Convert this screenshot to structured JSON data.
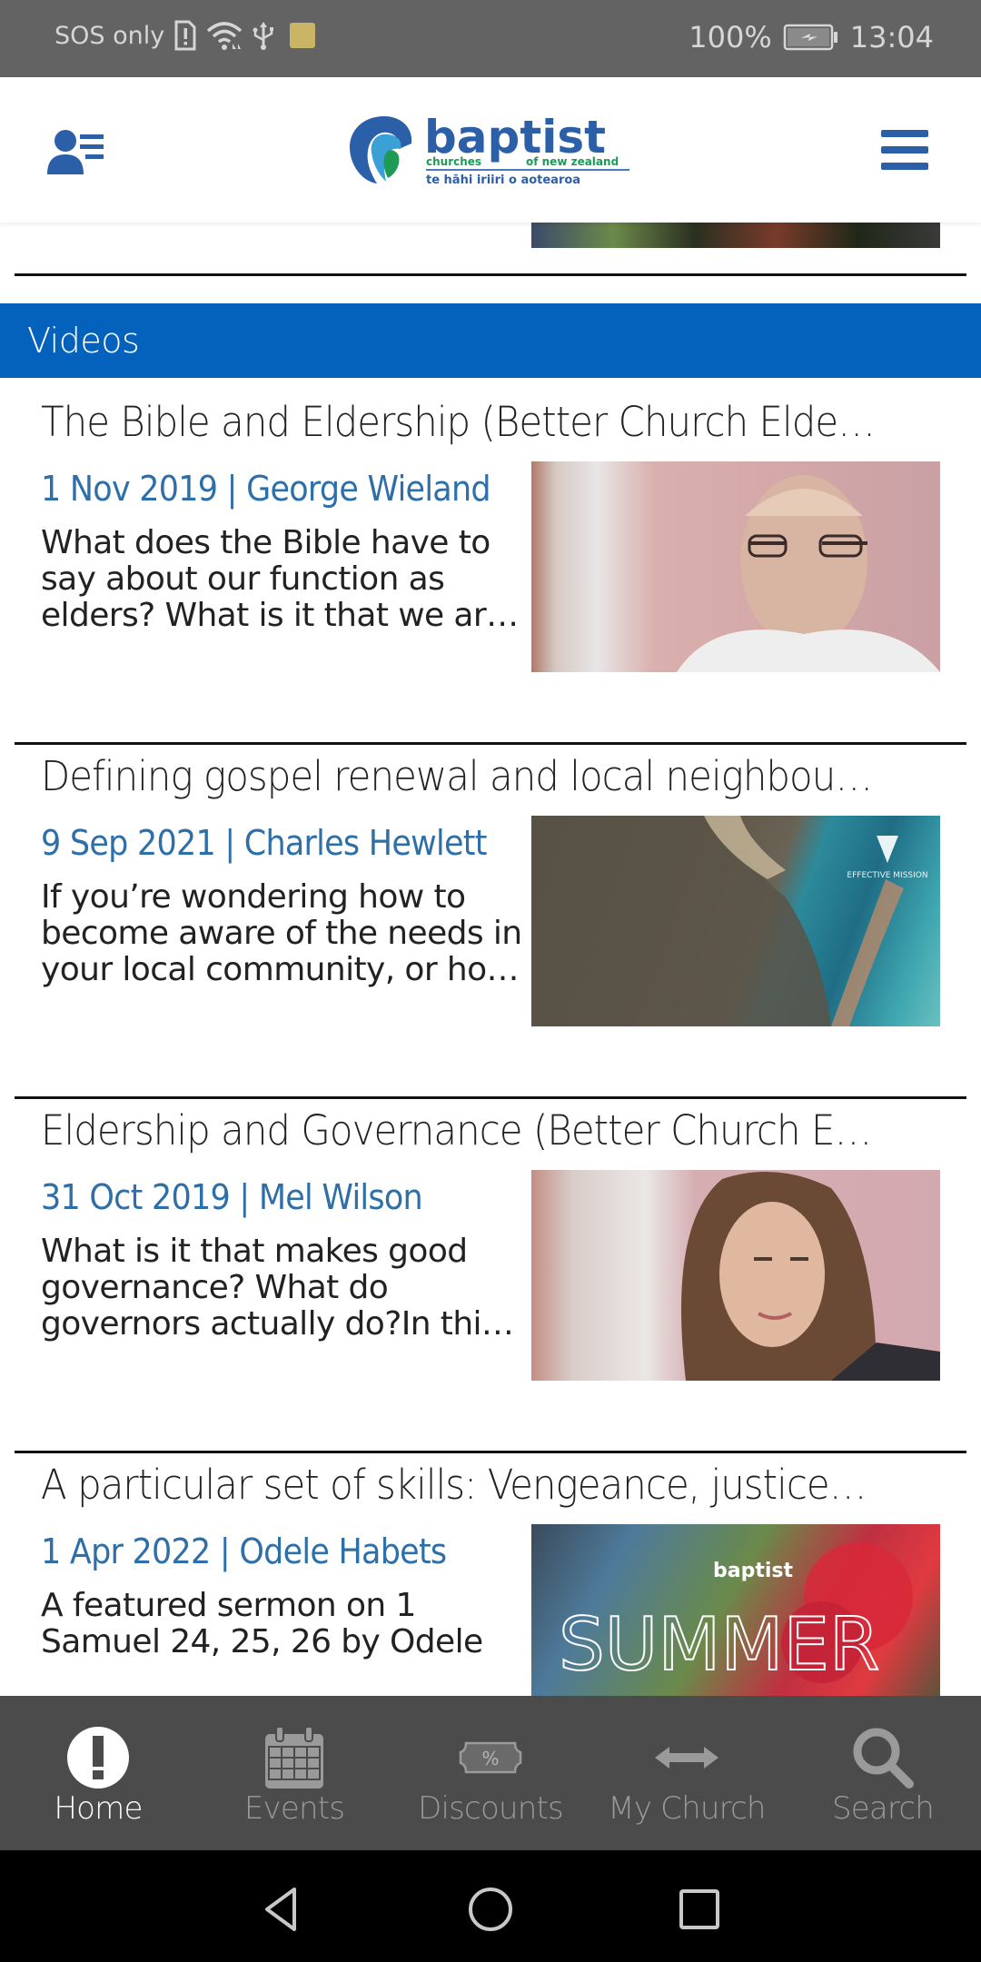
{
  "status_bar": {
    "carrier": "SOS only",
    "battery": "100%",
    "time": "13:04"
  },
  "header": {
    "logo_text": "baptist",
    "logo_subtitle_left": "churches",
    "logo_subtitle_right": "of new zealand",
    "logo_tagline": "te hāhi iriiri o aotearoa",
    "brand_color": "#2b5fa8",
    "accent_green": "#1e9a55"
  },
  "section": {
    "title": "Videos",
    "color": "#0462bc"
  },
  "videos": [
    {
      "title": "The Bible and Eldership (Better Church Elder…",
      "meta": "1 Nov 2019 | George Wieland",
      "description": "What does the Bible have to say about our function as elders? What is it that we ar…"
    },
    {
      "title": "Defining gospel renewal and local neighbour…",
      "meta": "9 Sep 2021 | Charles Hewlett",
      "description": "If you’re wondering how to become aware of the needs in your local community, or ho…"
    },
    {
      "title": "Eldership and Governance (Better Church El…",
      "meta": "31 Oct 2019 | Mel Wilson",
      "description": "What is it that makes good governance? What do governors actually do?In thi…"
    },
    {
      "title": "A particular set of skills: Vengeance, justice a…",
      "meta": "1 Apr 2022 | Odele Habets",
      "description": "A featured sermon on 1 Samuel 24, 25, 26 by Odele"
    }
  ],
  "thumb_overlays": {
    "map_caption": "EFFECTIVE MISSION",
    "flower_caption": "SUMMER",
    "flower_logo": "baptist"
  },
  "tabs": [
    {
      "label": "Home",
      "icon": "alert-circle-icon",
      "active": true
    },
    {
      "label": "Events",
      "icon": "calendar-icon",
      "active": false
    },
    {
      "label": "Discounts",
      "icon": "discount-tag-icon",
      "active": false
    },
    {
      "label": "My Church",
      "icon": "double-arrow-icon",
      "active": false
    },
    {
      "label": "Search",
      "icon": "search-icon",
      "active": false
    }
  ],
  "discount_symbol": "%"
}
